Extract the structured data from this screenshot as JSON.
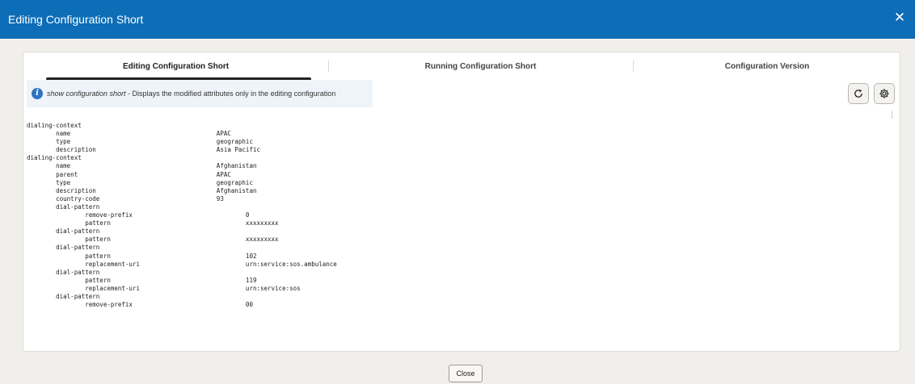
{
  "dialog": {
    "title": "Editing Configuration Short",
    "close_icon": "close-icon",
    "close_glyph": "✕"
  },
  "tabs": [
    {
      "label": "Editing Configuration Short",
      "selected": true
    },
    {
      "label": "Running Configuration Short",
      "selected": false
    },
    {
      "label": "Configuration Version",
      "selected": false
    }
  ],
  "info": {
    "icon": "info-icon",
    "icon_glyph": "i",
    "command": "show configuration short",
    "description": " - Displays the modified attributes only in the editing configuration"
  },
  "toolbar": {
    "refresh_icon": "refresh-icon",
    "settings_icon": "gear-icon"
  },
  "config_text": "dialing-context\n        name                                        APAC\n        type                                        geographic\n        description                                 Asia Pacific\ndialing-context\n        name                                        Afghanistan\n        parent                                      APAC\n        type                                        geographic\n        description                                 Afghanistan\n        country-code                                93\n        dial-pattern\n                remove-prefix                               0\n                pattern                                     xxxxxxxxx\n        dial-pattern\n                pattern                                     xxxxxxxxx\n        dial-pattern\n                pattern                                     102\n                replacement-uri                             urn:service:sos.ambulance\n        dial-pattern\n                pattern                                     119\n                replacement-uri                             urn:service:sos\n        dial-pattern\n                remove-prefix                               00",
  "footer": {
    "close_label": "Close"
  },
  "colors": {
    "titlebar": "#0d6db7",
    "info_icon": "#2f73c1",
    "info_bg": "#eef4f9",
    "page_bg": "#f0efec"
  }
}
